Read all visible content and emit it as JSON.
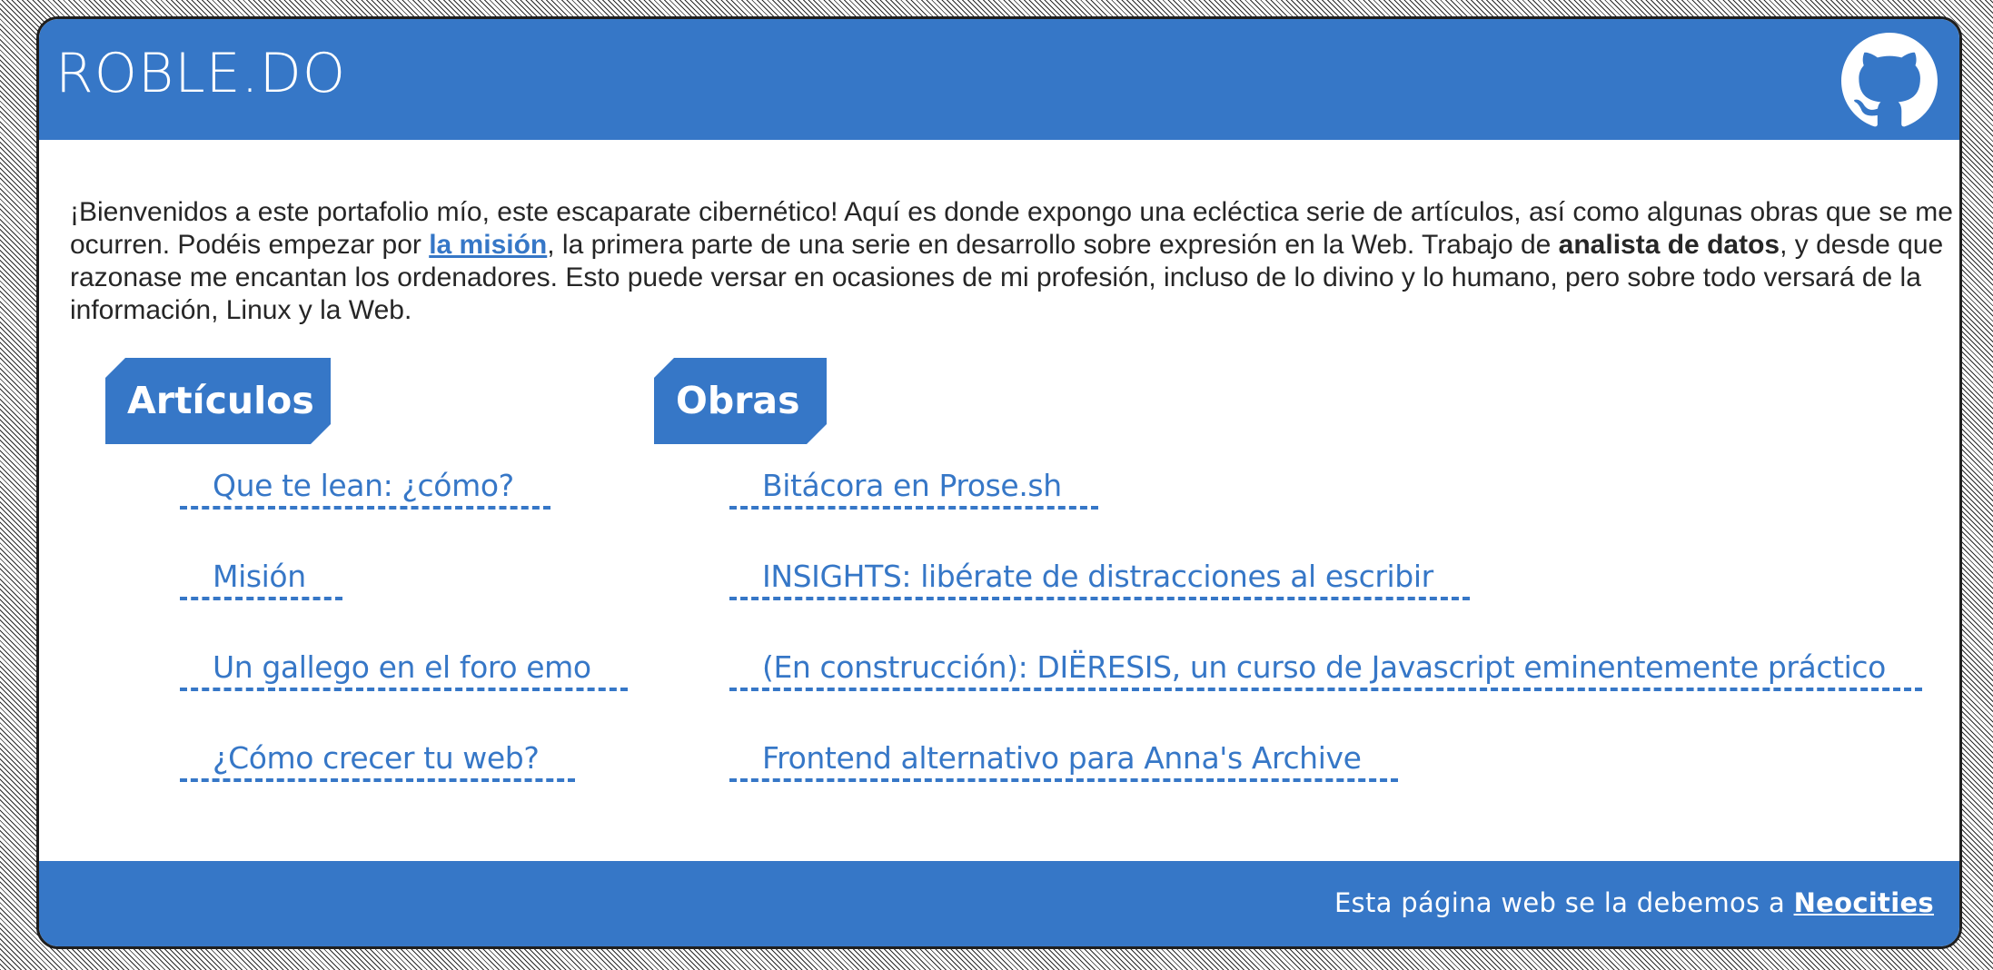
{
  "header": {
    "title": "ROBLE.DO",
    "github_icon": "github-icon"
  },
  "intro": {
    "part1": "¡Bienvenidos a este portafolio mío, este escaparate cibernético! Aquí es donde expongo una ecléctica serie de artículos, así como algunas obras que se me ocurren. Podéis empezar por ",
    "mission_link": "la misión",
    "part2": ", la primera parte de una serie en desarrollo sobre expresión en la Web. Trabajo de ",
    "bold_role": "analista de datos",
    "part3": ", y desde que razonase me encantan los ordenadores. Esto puede versar en ocasiones de mi profesión, incluso de lo divino y lo humano, pero sobre todo versará de la información, Linux y la Web."
  },
  "articulos": {
    "heading": "Artículos",
    "items": [
      "Que te lean: ¿cómo?",
      "Misión",
      "Un gallego en el foro emo",
      "¿Cómo crecer tu web?"
    ]
  },
  "obras": {
    "heading": "Obras",
    "items": [
      "Bitácora en Prose.sh",
      "INSIGHTS: libérate de distracciones al escribir",
      "(En construcción): DIËRESIS, un curso de Javascript eminentemente práctico",
      "Frontend alternativo para Anna's Archive"
    ]
  },
  "footer": {
    "text": "Esta página web se la debemos a ",
    "link": "Neocities"
  },
  "colors": {
    "accent": "#3677c7",
    "text": "#262626",
    "background_pattern": "#2a2a2a"
  }
}
